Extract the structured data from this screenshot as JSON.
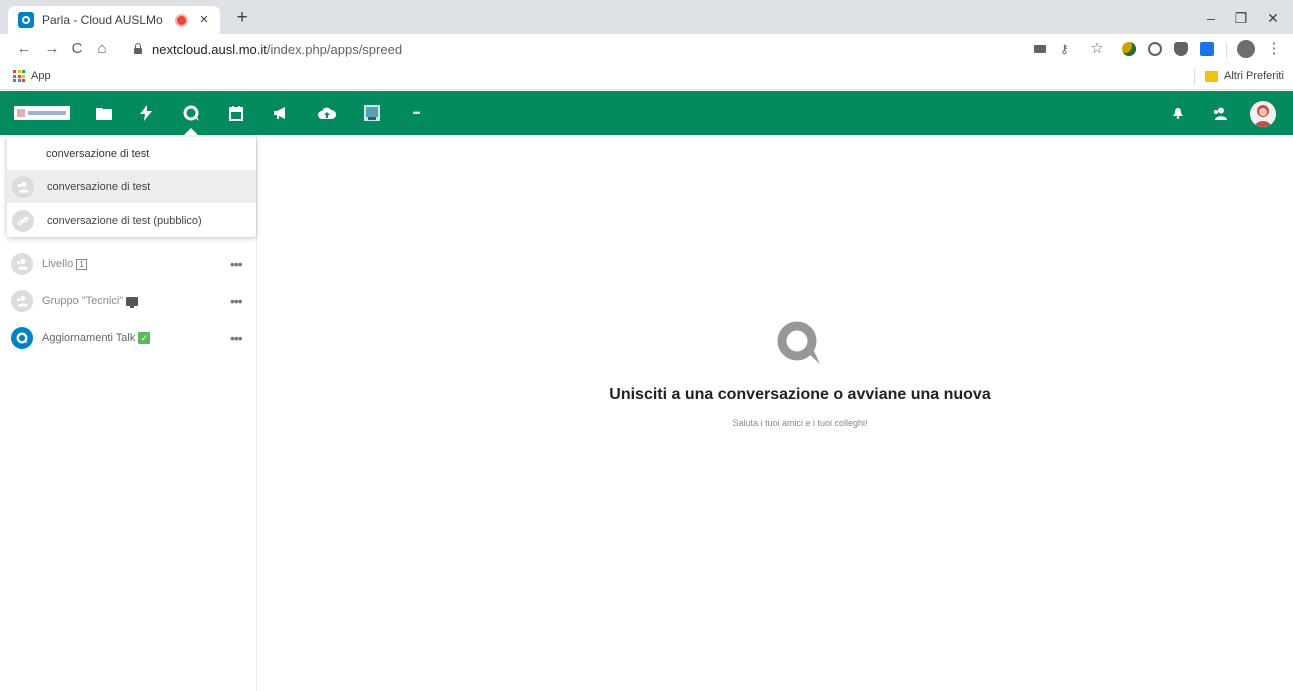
{
  "browser": {
    "tab_title": "Parla - Cloud AUSLMo",
    "tab_close": "×",
    "new_tab": "+",
    "window_minimize": "–",
    "window_restore": "❐",
    "window_close": "✕",
    "back": "←",
    "forward": "→",
    "reload": "C",
    "home": "⌂",
    "url_host": "nextcloud.ausl.mo.it",
    "url_path": "/index.php/apps/spreed",
    "bookmark_star": "☆",
    "menu": "⋮",
    "apps_label": "App",
    "other_bookmarks": "Altri Preferiti"
  },
  "header": {
    "brand_color": "#038a5e",
    "apps": [
      {
        "name": "files-icon"
      },
      {
        "name": "activity-icon"
      },
      {
        "name": "talk-icon",
        "active": true
      },
      {
        "name": "calendar-icon"
      },
      {
        "name": "announcements-icon"
      },
      {
        "name": "cloud-upload-icon"
      },
      {
        "name": "whiteboard-icon"
      },
      {
        "name": "more-apps-icon"
      }
    ],
    "more_dots": "•••"
  },
  "search": {
    "value": "conversazione di test",
    "results": [
      {
        "label": "conversazione di test",
        "icon": "group-icon",
        "selected": true
      },
      {
        "label": "conversazione di test (pubblico)",
        "icon": "link-icon",
        "selected": false
      }
    ]
  },
  "conversations": [
    {
      "name": "Livello",
      "badge": "1",
      "icon": "group-icon"
    },
    {
      "name": "Gruppo \"Tecnici\"",
      "badge_icon": "monitor-icon",
      "icon": "group-icon"
    },
    {
      "name": "Aggiornamenti Talk",
      "badge": "✓",
      "icon": "talk-icon"
    }
  ],
  "more_dots": "•••",
  "empty": {
    "title": "Unisciti a una conversazione o avviane una nuova",
    "subtitle": "Saluta i tuoi amici e i tuoi colleghi!"
  }
}
